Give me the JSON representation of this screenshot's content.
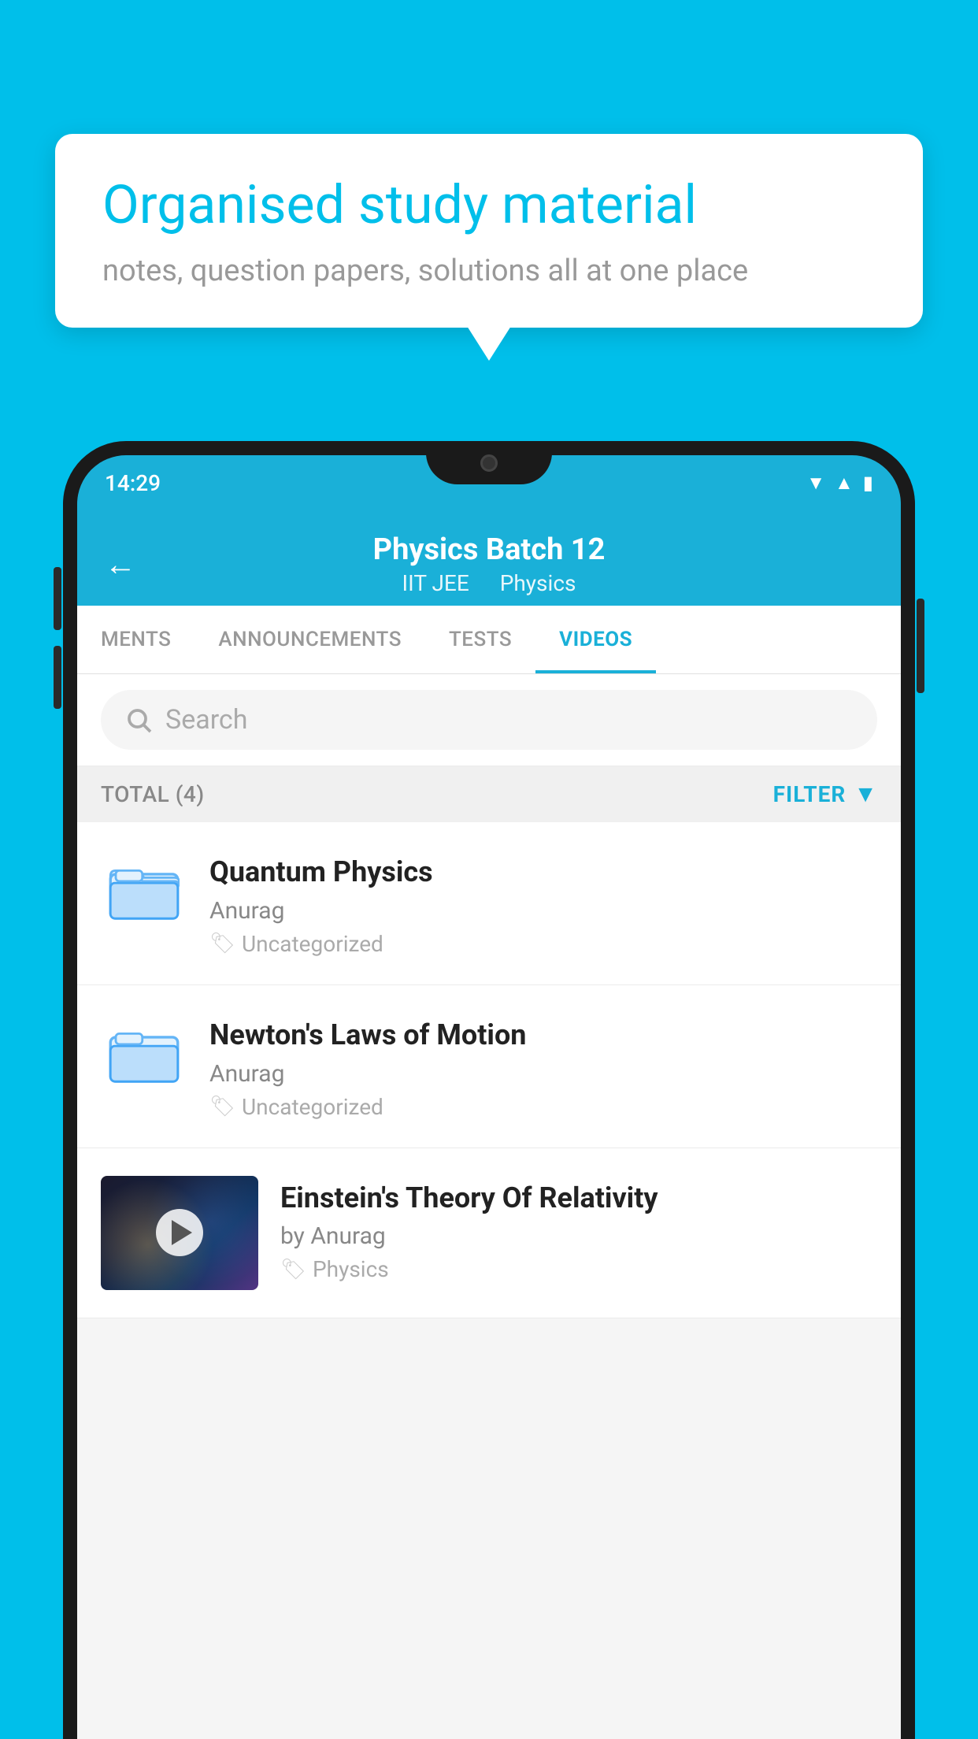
{
  "background": {
    "color": "#00BFEA"
  },
  "speech_bubble": {
    "title": "Organised study material",
    "subtitle": "notes, question papers, solutions all at one place"
  },
  "status_bar": {
    "time": "14:29",
    "icons": [
      "wifi",
      "signal",
      "battery"
    ]
  },
  "header": {
    "back_label": "←",
    "title": "Physics Batch 12",
    "subtitle_left": "IIT JEE",
    "subtitle_right": "Physics"
  },
  "tabs": [
    {
      "label": "MENTS",
      "active": false
    },
    {
      "label": "ANNOUNCEMENTS",
      "active": false
    },
    {
      "label": "TESTS",
      "active": false
    },
    {
      "label": "VIDEOS",
      "active": true
    }
  ],
  "search": {
    "placeholder": "Search"
  },
  "filter_bar": {
    "total_label": "TOTAL (4)",
    "filter_label": "FILTER"
  },
  "videos": [
    {
      "id": 1,
      "title": "Quantum Physics",
      "author": "Anurag",
      "tag": "Uncategorized",
      "has_thumbnail": false
    },
    {
      "id": 2,
      "title": "Newton's Laws of Motion",
      "author": "Anurag",
      "tag": "Uncategorized",
      "has_thumbnail": false
    },
    {
      "id": 3,
      "title": "Einstein's Theory Of Relativity",
      "author": "by Anurag",
      "tag": "Physics",
      "has_thumbnail": true
    }
  ]
}
